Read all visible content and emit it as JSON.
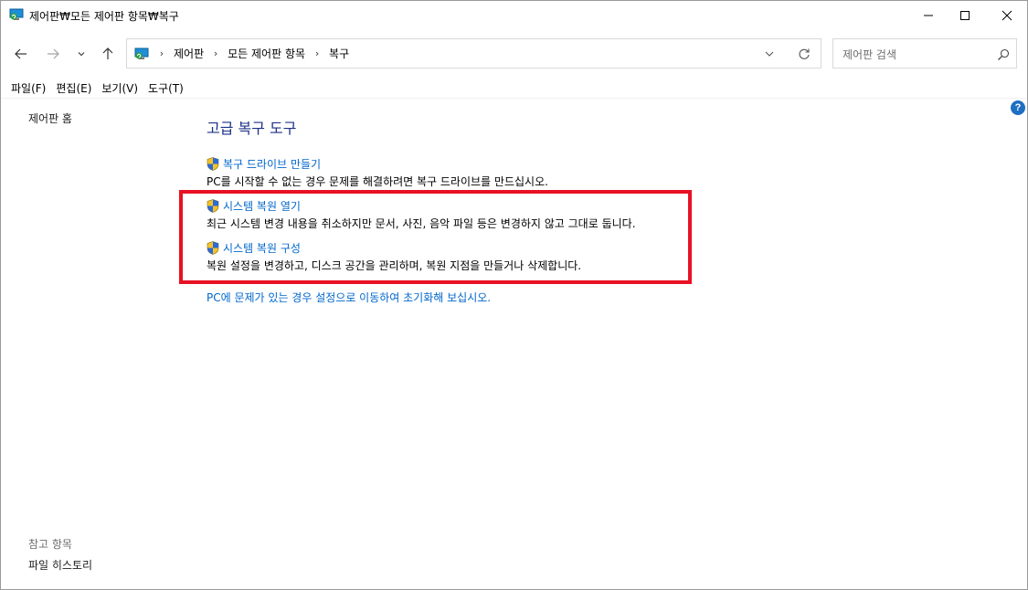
{
  "window": {
    "title": "제어판₩모든 제어판 항목₩복구"
  },
  "titlebar": {
    "minimize_glyph": "—",
    "maximize_glyph": "☐",
    "close_glyph": "✕"
  },
  "nav": {
    "back_icon": "arrow-left-icon",
    "forward_icon": "arrow-right-icon",
    "recent_icon": "chevron-down-icon",
    "up_icon": "arrow-up-icon"
  },
  "address": {
    "breadcrumbs": [
      "제어판",
      "모든 제어판 항목",
      "복구"
    ],
    "separator": "›"
  },
  "search": {
    "placeholder": "제어판 검색"
  },
  "menu": {
    "items": [
      "파일(F)",
      "편집(E)",
      "보기(V)",
      "도구(T)"
    ]
  },
  "sidebar": {
    "home_link": "제어판 홈",
    "see_also_title": "참고 항목",
    "see_also_link": "파일 히스토리"
  },
  "help": {
    "glyph": "?"
  },
  "main": {
    "title": "고급 복구 도구",
    "tasks": [
      {
        "link": "복구 드라이브 만들기",
        "description": "PC를 시작할 수 없는 경우 문제를 해결하려면 복구 드라이브를 만드십시오."
      },
      {
        "link": "시스템 복원 열기",
        "description": "최근 시스템 변경 내용을 취소하지만 문서, 사진, 음악 파일 등은 변경하지 않고 그대로 둡니다."
      },
      {
        "link": "시스템 복원 구성",
        "description": "복원 설정을 변경하고, 디스크 공간을 관리하며, 복원 지점을 만들거나 삭제합니다."
      }
    ],
    "reset_link": "PC에 문제가 있는 경우 설정으로 이동하여 초기화해 보십시오."
  },
  "colors": {
    "link": "#0066cc",
    "title": "#1e3287",
    "highlight": "#e81123",
    "help": "#1f6fc3"
  }
}
